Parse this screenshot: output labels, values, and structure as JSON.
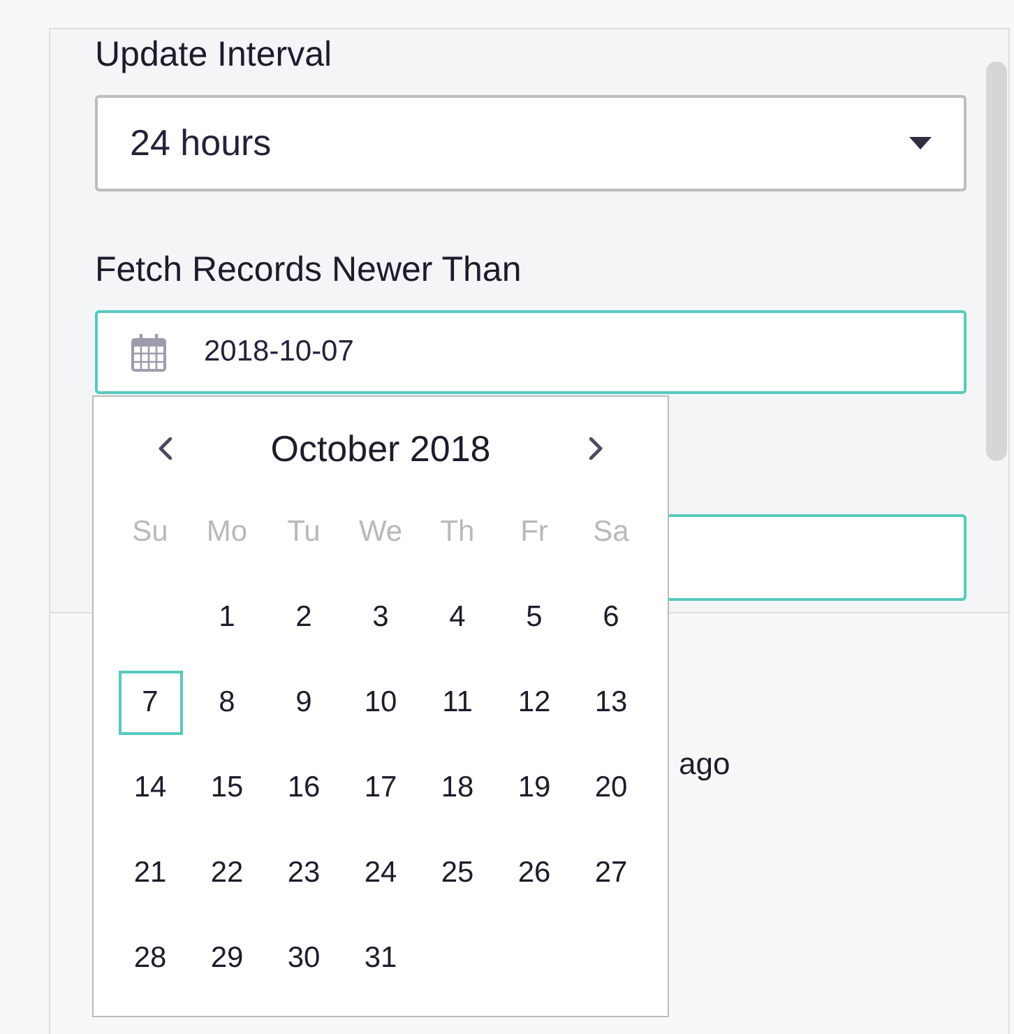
{
  "settings_panel": {
    "fields": [
      {
        "kind": "select",
        "label": "Update Interval",
        "value": "24 hours",
        "focused": false
      },
      {
        "kind": "date",
        "label": "Fetch Records Newer Than",
        "value": "2018-10-07",
        "focused": true
      },
      {
        "kind": "text",
        "focused": true
      }
    ]
  },
  "calendar": {
    "title": "October 2018",
    "weekdays": [
      "Su",
      "Mo",
      "Tu",
      "We",
      "Th",
      "Fr",
      "Sa"
    ],
    "weeks": [
      [
        {
          "label": "1",
          "selected": false
        },
        {
          "label": "2",
          "selected": false
        },
        {
          "label": "3",
          "selected": false
        },
        {
          "label": "4",
          "selected": false
        },
        {
          "label": "5",
          "selected": false
        },
        {
          "label": "6",
          "selected": false
        }
      ],
      [
        {
          "label": "7",
          "selected": true
        },
        {
          "label": "8",
          "selected": false
        },
        {
          "label": "9",
          "selected": false
        },
        {
          "label": "10",
          "selected": false
        },
        {
          "label": "11",
          "selected": false
        },
        {
          "label": "12",
          "selected": false
        },
        {
          "label": "13",
          "selected": false
        }
      ],
      [
        {
          "label": "14",
          "selected": false
        },
        {
          "label": "15",
          "selected": false
        },
        {
          "label": "16",
          "selected": false
        },
        {
          "label": "17",
          "selected": false
        },
        {
          "label": "18",
          "selected": false
        },
        {
          "label": "19",
          "selected": false
        },
        {
          "label": "20",
          "selected": false
        }
      ],
      [
        {
          "label": "21",
          "selected": false
        },
        {
          "label": "22",
          "selected": false
        },
        {
          "label": "23",
          "selected": false
        },
        {
          "label": "24",
          "selected": false
        },
        {
          "label": "25",
          "selected": false
        },
        {
          "label": "26",
          "selected": false
        },
        {
          "label": "27",
          "selected": false
        }
      ],
      [
        {
          "label": "28",
          "selected": false
        },
        {
          "label": "29",
          "selected": false
        },
        {
          "label": "30",
          "selected": false
        },
        {
          "label": "31",
          "selected": false
        }
      ]
    ]
  },
  "details": {
    "text": "ago"
  }
}
